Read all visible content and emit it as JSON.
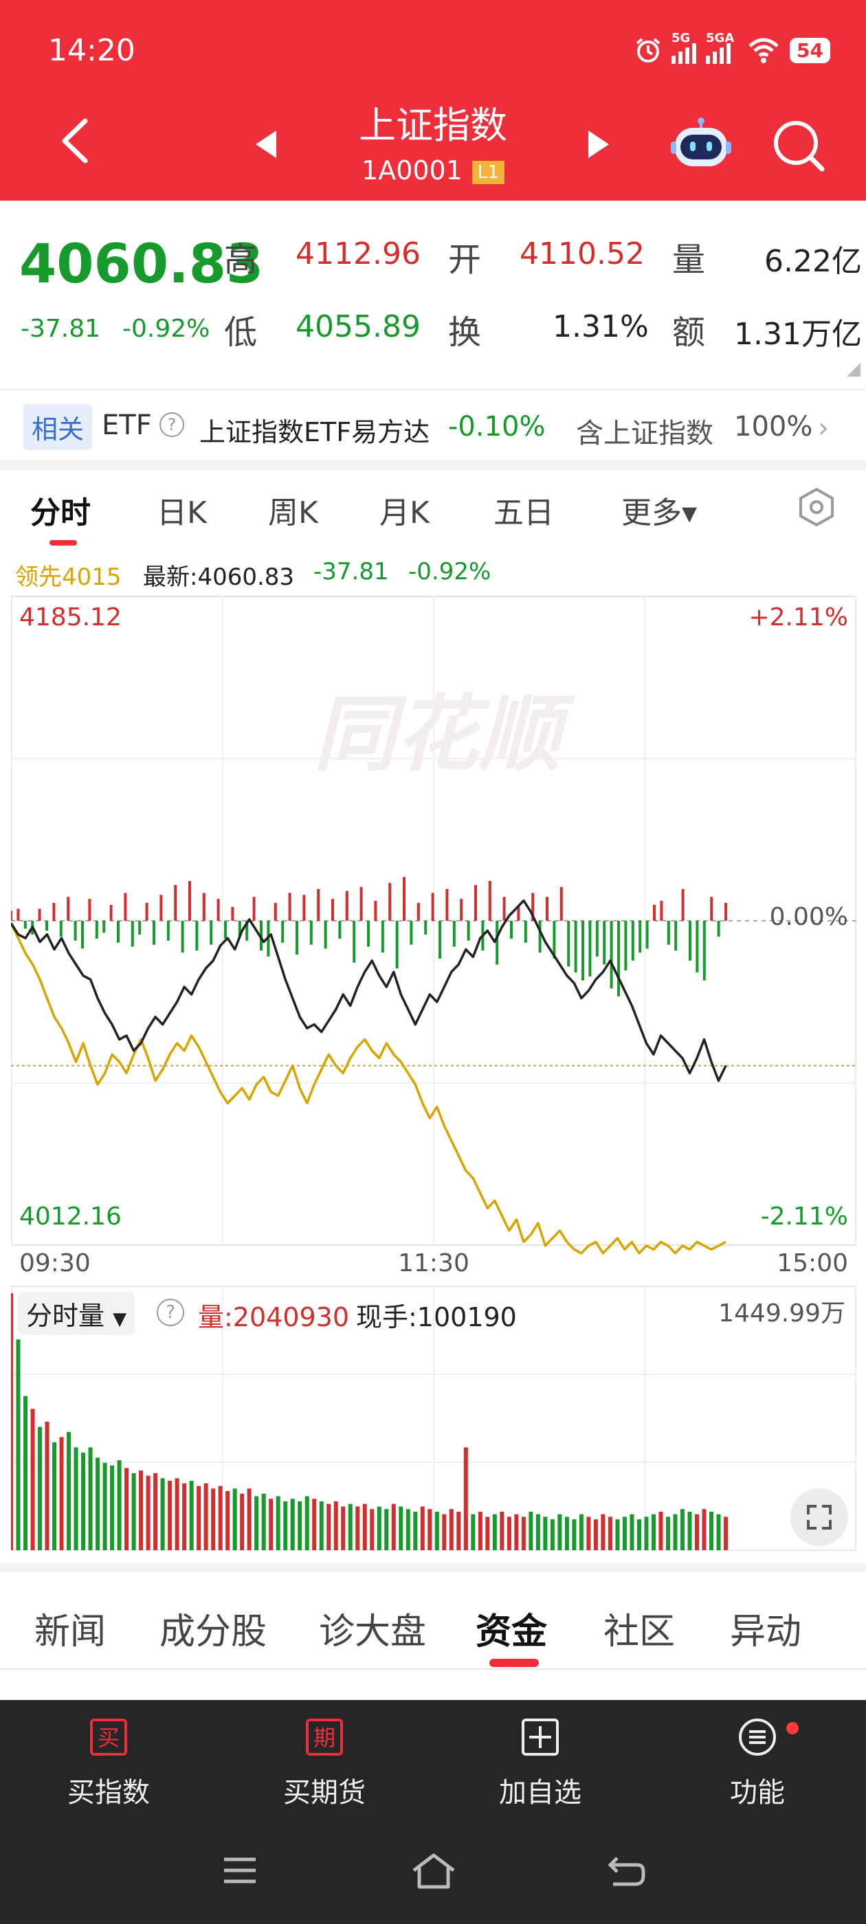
{
  "status_bar": {
    "time": "14:20",
    "battery": "54",
    "signal1": "5G",
    "signal2": "5GA"
  },
  "header": {
    "title": "上证指数",
    "code": "1A0001",
    "level": "L1"
  },
  "quote": {
    "price": "4060.83",
    "change": "-37.81",
    "change_pct": "-0.92%",
    "high_label": "高",
    "high": "4112.96",
    "open_label": "开",
    "open": "4110.52",
    "volume_label": "量",
    "volume": "6.22亿",
    "low_label": "低",
    "low": "4055.89",
    "turnover_label": "换",
    "turnover": "1.31%",
    "amount_label": "额",
    "amount": "1.31万亿"
  },
  "etf_row": {
    "tag": "相关",
    "label": "ETF",
    "name": "上证指数ETF易方达",
    "change": "-0.10%",
    "contains_label": "含上证指数",
    "contains_pct": "100%"
  },
  "chart_tabs": [
    "分时",
    "日K",
    "周K",
    "月K",
    "五日",
    "更多▾"
  ],
  "chart_info": {
    "lead_label": "领先4015",
    "latest_label": "最新:4060.83",
    "latest_change": "-37.81",
    "latest_pct": "-0.92%"
  },
  "chart_data": {
    "type": "line",
    "y_top": "4185.12",
    "y_bottom": "4012.16",
    "pct_top": "+2.11%",
    "pct_mid": "0.00%",
    "pct_bottom": "-2.11%",
    "x_start": "09:30",
    "x_mid": "11:30",
    "x_end": "15:00",
    "ylim": [
      4012.16,
      4185.12
    ],
    "prev_close": 4098.64,
    "series": [
      {
        "name": "最新",
        "values": [
          4098,
          4095,
          4094,
          4097,
          4093,
          4095,
          4091,
          4094,
          4090,
          4087,
          4084,
          4083,
          4078,
          4074,
          4071,
          4067,
          4068,
          4064,
          4066,
          4070,
          4073,
          4071,
          4074,
          4077,
          4081,
          4079,
          4083,
          4086,
          4088,
          4092,
          4094,
          4091,
          4096,
          4099,
          4096,
          4093,
          4095,
          4089,
          4083,
          4078,
          4073,
          4070,
          4071,
          4069,
          4072,
          4075,
          4079,
          4076,
          4081,
          4085,
          4088,
          4084,
          4081,
          4085,
          4079,
          4075,
          4071,
          4075,
          4079,
          4077,
          4081,
          4085,
          4087,
          4091,
          4089,
          4094,
          4096,
          4093,
          4097,
          4100,
          4102,
          4104,
          4101,
          4097,
          4093,
          4090,
          4087,
          4084,
          4082,
          4078,
          4080,
          4083,
          4085,
          4088,
          4084,
          4080,
          4076,
          4071,
          4066,
          4063,
          4068,
          4066,
          4064,
          4062,
          4058,
          4062,
          4067,
          4061,
          4056,
          4060
        ]
      },
      {
        "name": "领先",
        "values": [
          4098,
          4094,
          4090,
          4087,
          4083,
          4078,
          4073,
          4070,
          4066,
          4061,
          4066,
          4060,
          4055,
          4058,
          4063,
          4061,
          4058,
          4063,
          4067,
          4062,
          4056,
          4059,
          4063,
          4066,
          4064,
          4068,
          4065,
          4061,
          4057,
          4053,
          4050,
          4052,
          4054,
          4051,
          4055,
          4057,
          4053,
          4052,
          4056,
          4060,
          4054,
          4050,
          4055,
          4059,
          4063,
          4060,
          4058,
          4062,
          4065,
          4067,
          4064,
          4062,
          4066,
          4063,
          4061,
          4058,
          4055,
          4050,
          4046,
          4049,
          4044,
          4040,
          4036,
          4032,
          4030,
          4026,
          4022,
          4024,
          4020,
          4016,
          4019,
          4013,
          4015,
          4018,
          4012,
          4014,
          4016,
          4013,
          4011,
          4010,
          4012,
          4013,
          4010,
          4012,
          4014,
          4011,
          4013,
          4010,
          4012,
          4011,
          4013,
          4012,
          4010,
          4012,
          4011,
          4013,
          4012,
          4011,
          4012,
          4013
        ]
      }
    ],
    "net_flow": [
      5,
      6,
      -4,
      -7,
      6,
      -5,
      9,
      -8,
      12,
      -10,
      -14,
      11,
      -9,
      -6,
      8,
      -11,
      14,
      -13,
      -7,
      9,
      -12,
      13,
      -10,
      18,
      -16,
      20,
      -15,
      14,
      -12,
      11,
      -9,
      7,
      -8,
      -10,
      12,
      -15,
      -18,
      9,
      -11,
      14,
      -17,
      13,
      -12,
      16,
      -14,
      11,
      -9,
      15,
      -21,
      17,
      -13,
      10,
      -16,
      19,
      -24,
      22,
      -12,
      9,
      -7,
      14,
      -19,
      16,
      -13,
      11,
      -10,
      18,
      -15,
      20,
      -22,
      12,
      -9,
      7,
      -11,
      14,
      -16,
      12,
      -19,
      17,
      -23,
      -26,
      -30,
      -28,
      -18,
      -22,
      -34,
      -38,
      -25,
      -20,
      -16,
      -14,
      8,
      10,
      -12,
      -15,
      16,
      -20,
      -26,
      -30,
      12,
      -8,
      9
    ],
    "volume_max": "1449.99万",
    "volume_bars": [
      100,
      82,
      60,
      55,
      48,
      50,
      42,
      44,
      46,
      40,
      38,
      40,
      36,
      34,
      33,
      35,
      32,
      30,
      31,
      29,
      30,
      28,
      27,
      28,
      26,
      27,
      25,
      26,
      24,
      25,
      23,
      24,
      22,
      24,
      21,
      22,
      20,
      21,
      19,
      20,
      19,
      21,
      20,
      19,
      18,
      19,
      17,
      18,
      17,
      18,
      16,
      17,
      16,
      18,
      17,
      16,
      15,
      17,
      16,
      15,
      14,
      16,
      15,
      40,
      14,
      15,
      13,
      14,
      15,
      13,
      14,
      13,
      15,
      14,
      13,
      12,
      14,
      13,
      12,
      14,
      13,
      12,
      14,
      13,
      12,
      13,
      14,
      12,
      13,
      14,
      15,
      13,
      14,
      16,
      15,
      14,
      16,
      15,
      14,
      13
    ]
  },
  "volume_panel": {
    "selector": "分时量",
    "volume_label": "量:2040930",
    "hand_label": "现手:100190",
    "max_label": "1449.99万"
  },
  "news_tabs": [
    "新闻",
    "成分股",
    "诊大盘",
    "资金",
    "社区",
    "异动"
  ],
  "bottom_bar": [
    {
      "label": "买指数",
      "icon_text": "买"
    },
    {
      "label": "买期货",
      "icon_text": "期"
    },
    {
      "label": "加自选",
      "icon_text": "+"
    },
    {
      "label": "功能",
      "icon_text": "≡"
    }
  ],
  "colors": {
    "brand": "#ee2f3b",
    "up": "#d42d2d",
    "down": "#169a2b",
    "lead": "#d9a400",
    "nav_bg": "#262626"
  }
}
